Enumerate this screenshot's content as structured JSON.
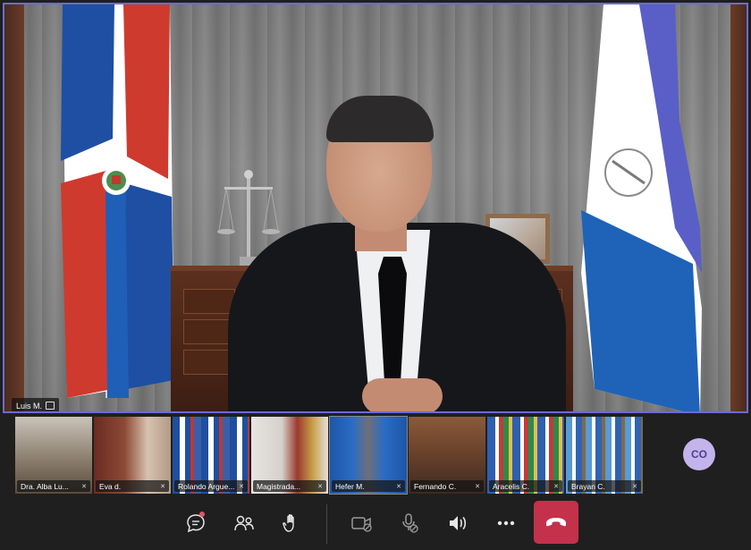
{
  "speaker": {
    "name": "Luis M."
  },
  "participants": [
    {
      "name": "Dra. Alba Lu..."
    },
    {
      "name": "Eva d."
    },
    {
      "name": "Rolando Argue..."
    },
    {
      "name": "Magistrada..."
    },
    {
      "name": "Hefer M."
    },
    {
      "name": "Fernando C."
    },
    {
      "name": "Aracelis C."
    },
    {
      "name": "Brayan C."
    }
  ],
  "overflow_avatar": {
    "initials": "CO"
  },
  "controls": {
    "chat": "chat-icon",
    "people": "people-icon",
    "raise_hand": "hand-icon",
    "camera": "camera-off-icon",
    "mic": "mic-off-icon",
    "speaker": "speaker-icon",
    "more": "more-icon",
    "hangup": "hangup-icon"
  },
  "colors": {
    "active_speaker_border": "#6b6bd6",
    "hangup": "#c4314b",
    "avatar_bg": "#c3b5ec",
    "notification_dot": "#e0566b"
  }
}
